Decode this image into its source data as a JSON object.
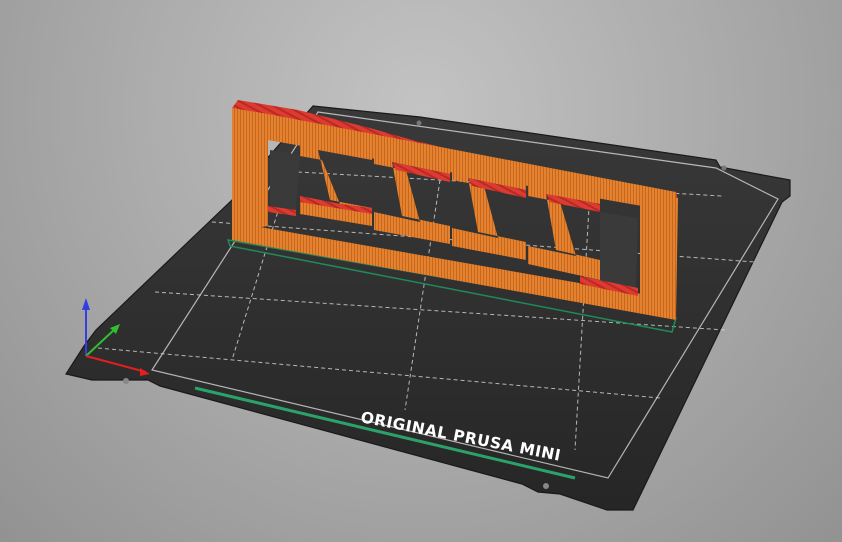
{
  "viewport": {
    "bed_label": "ORIGINAL PRUSA MINI",
    "bed_label_color": "#ffffff",
    "background_color": "#b4b4b4",
    "bed_color": "#2f2f2f",
    "grid_color": "#d9d9d9"
  },
  "model": {
    "side_color": "#e07a2c",
    "top_color": "#d8382e",
    "infill_color": "#e0413a",
    "outline_color": "#1f8a5a"
  },
  "axes": {
    "x_color": "#e02020",
    "y_color": "#2fbf2f",
    "z_color": "#2f3fe0"
  },
  "icons": [
    "axis-gizmo-icon"
  ]
}
